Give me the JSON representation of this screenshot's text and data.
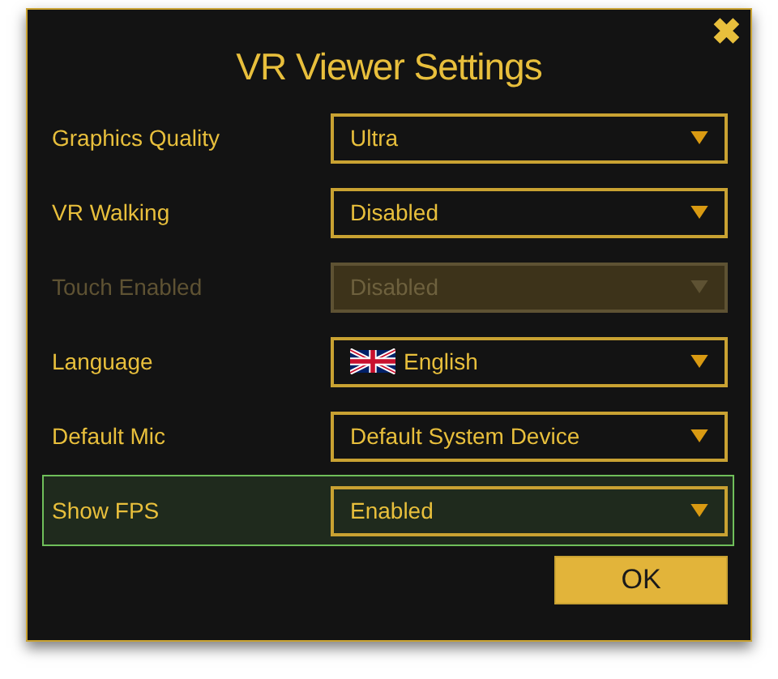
{
  "dialog": {
    "title": "VR Viewer Settings",
    "close": "✖"
  },
  "settings": [
    {
      "label": "Graphics Quality",
      "value": "Ultra",
      "disabled": false,
      "selected": false,
      "flag": false
    },
    {
      "label": "VR Walking",
      "value": "Disabled",
      "disabled": false,
      "selected": false,
      "flag": false
    },
    {
      "label": "Touch Enabled",
      "value": "Disabled",
      "disabled": true,
      "selected": false,
      "flag": false
    },
    {
      "label": "Language",
      "value": "English",
      "disabled": false,
      "selected": false,
      "flag": true
    },
    {
      "label": "Default Mic",
      "value": "Default System Device",
      "disabled": false,
      "selected": false,
      "flag": false
    },
    {
      "label": "Show FPS",
      "value": "Enabled",
      "disabled": false,
      "selected": true,
      "flag": false
    }
  ],
  "buttons": [
    "OK"
  ]
}
